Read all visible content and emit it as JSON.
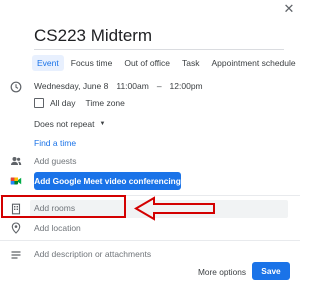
{
  "dialog": {
    "close_icon": "close-icon",
    "title": "CS223 Midterm",
    "tabs": [
      {
        "label": "Event",
        "active": true
      },
      {
        "label": "Focus time",
        "active": false
      },
      {
        "label": "Out of office",
        "active": false
      },
      {
        "label": "Task",
        "active": false
      },
      {
        "label": "Appointment schedule",
        "active": false
      }
    ],
    "datetime": {
      "icon": "clock-icon",
      "date": "Wednesday, June 8",
      "start": "11:00am",
      "separator": "–",
      "end": "12:00pm"
    },
    "all_day_label": "All day",
    "time_zone_label": "Time zone",
    "repeat": {
      "value": "Does not repeat",
      "caret": "▼"
    },
    "find_time_label": "Find a time",
    "guests": {
      "icon": "people-icon",
      "placeholder": "Add guests"
    },
    "meet": {
      "icon": "google-meet-icon",
      "label": "Add Google Meet video conferencing"
    },
    "rooms": {
      "icon": "building-icon",
      "placeholder": "Add rooms"
    },
    "location": {
      "icon": "location-pin-icon",
      "placeholder": "Add location"
    },
    "description": {
      "icon": "notes-icon",
      "placeholder": "Add description or attachments"
    },
    "footer": {
      "more_options_label": "More options",
      "save_label": "Save"
    }
  },
  "annotation": {
    "highlight_color": "#d30000"
  },
  "colors": {
    "accent": "#1a73e8",
    "tab_active_bg": "#e8f0fe"
  }
}
